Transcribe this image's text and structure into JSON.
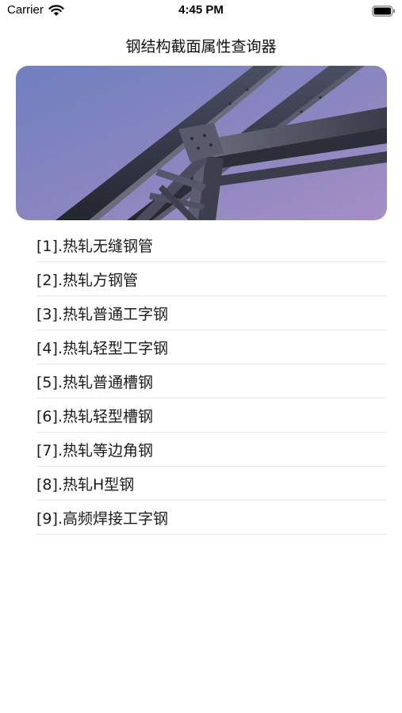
{
  "status_bar": {
    "carrier": "Carrier",
    "time": "4:45 PM"
  },
  "nav": {
    "title": "钢结构截面属性查询器"
  },
  "banner": {
    "icon": "steel-beam-photo"
  },
  "list": {
    "items": [
      {
        "label": "[1].热轧无缝钢管"
      },
      {
        "label": "[2].热轧方钢管"
      },
      {
        "label": "[3].热轧普通工字钢"
      },
      {
        "label": "[4].热轧轻型工字钢"
      },
      {
        "label": "[5].热轧普通槽钢"
      },
      {
        "label": "[6].热轧轻型槽钢"
      },
      {
        "label": "[7].热轧等边角钢"
      },
      {
        "label": "[8].热轧H型钢"
      },
      {
        "label": "[9].高频焊接工字钢"
      }
    ]
  }
}
